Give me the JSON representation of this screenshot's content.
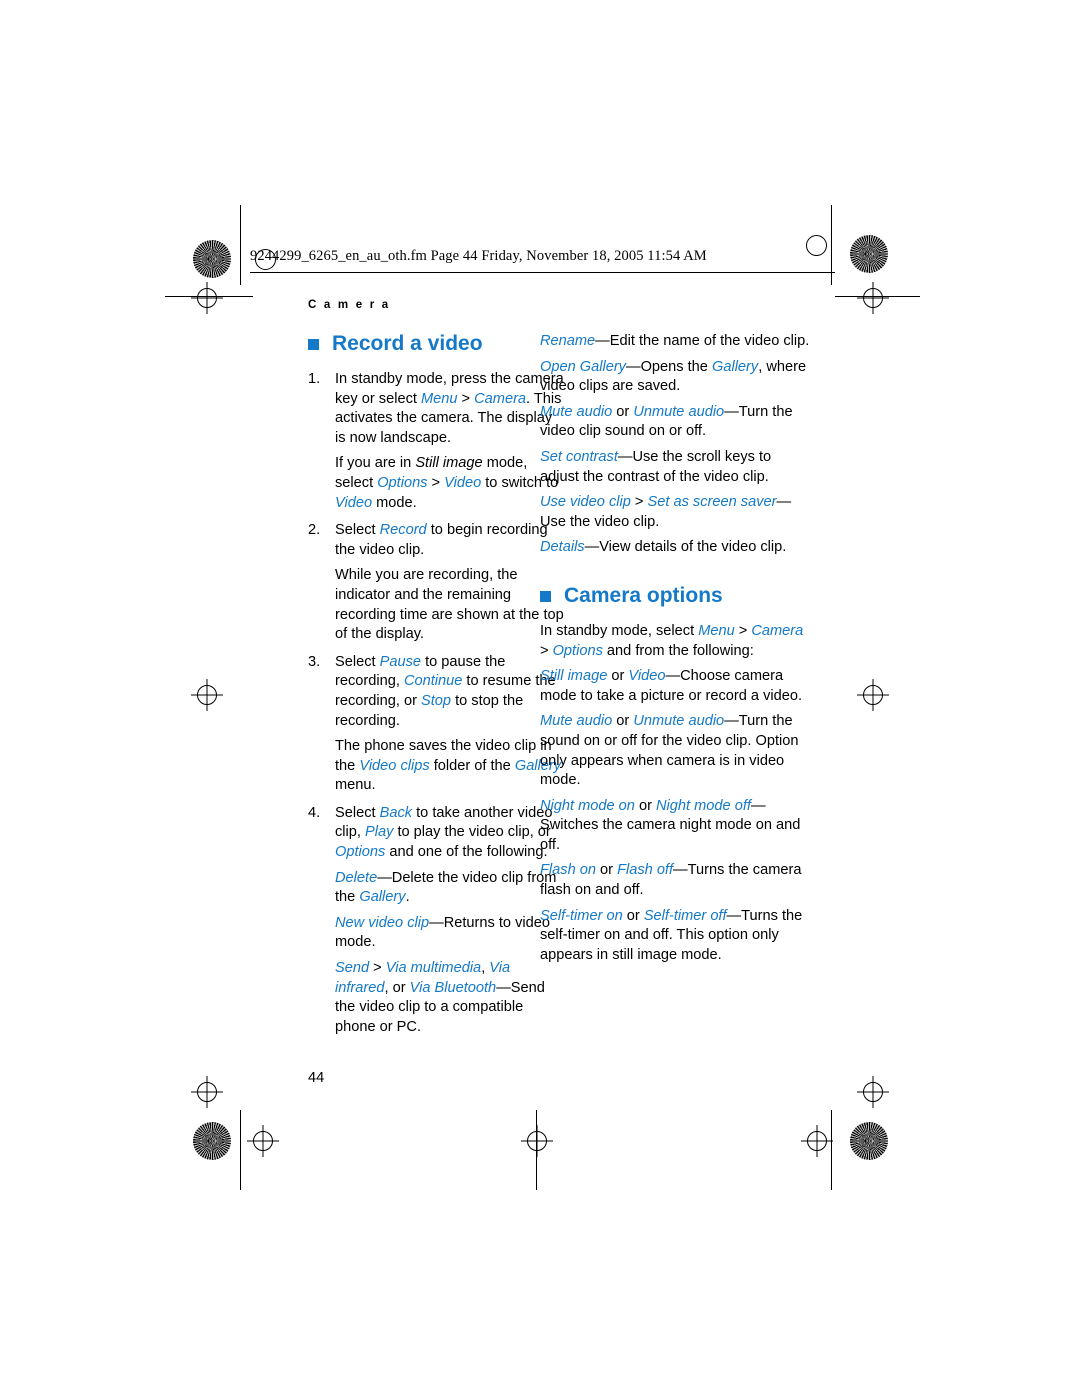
{
  "header": {
    "filename_line": "9244299_6265_en_au_oth.fm  Page 44  Friday, November 18, 2005  11:54 AM",
    "running_head": "C a m e r a"
  },
  "page_number": "44",
  "left_column": {
    "section_title": "Record a video",
    "steps": [
      {
        "num": "1.",
        "parts": [
          {
            "t": "In standby mode, press the camera key or select ",
            "s": "plain"
          },
          {
            "t": "Menu",
            "s": "italic-blue"
          },
          {
            "t": " > ",
            "s": "plain"
          },
          {
            "t": "Camera",
            "s": "italic-blue"
          },
          {
            "t": ". This activates the camera. The display is now landscape.",
            "s": "plain"
          }
        ]
      },
      {
        "num": "2.",
        "parts": [
          {
            "t": "Select ",
            "s": "plain"
          },
          {
            "t": "Record",
            "s": "italic-blue"
          },
          {
            "t": " to begin recording the video clip.",
            "s": "plain"
          }
        ]
      },
      {
        "num": "3.",
        "parts": [
          {
            "t": "Select ",
            "s": "plain"
          },
          {
            "t": "Pause",
            "s": "italic-blue"
          },
          {
            "t": " to pause the recording, ",
            "s": "plain"
          },
          {
            "t": "Continue",
            "s": "italic-blue"
          },
          {
            "t": " to resume the recording, or ",
            "s": "plain"
          },
          {
            "t": "Stop",
            "s": "italic-blue"
          },
          {
            "t": " to stop the recording.",
            "s": "plain"
          }
        ]
      },
      {
        "num": "4.",
        "parts": [
          {
            "t": "Select ",
            "s": "plain"
          },
          {
            "t": "Back",
            "s": "italic-blue"
          },
          {
            "t": " to take another video clip, ",
            "s": "plain"
          },
          {
            "t": "Play",
            "s": "italic-blue"
          },
          {
            "t": " to play the video clip, or ",
            "s": "plain"
          },
          {
            "t": "Options",
            "s": "italic-blue"
          },
          {
            "t": " and one of the following.",
            "s": "plain"
          }
        ]
      }
    ],
    "para_1_after_step1": [
      {
        "t": "If you are in ",
        "s": "plain"
      },
      {
        "t": "Still image",
        "s": "italic-black"
      },
      {
        "t": " mode, select ",
        "s": "plain"
      },
      {
        "t": "Options",
        "s": "italic-blue"
      },
      {
        "t": " > ",
        "s": "plain"
      },
      {
        "t": "Video",
        "s": "italic-blue"
      },
      {
        "t": " to switch to ",
        "s": "plain"
      },
      {
        "t": "Video",
        "s": "italic-blue"
      },
      {
        "t": " mode.",
        "s": "plain"
      }
    ],
    "para_after_step2": [
      {
        "t": "While you are recording, the indicator and the remaining recording time are shown at the top of the display.",
        "s": "plain"
      }
    ],
    "para_after_step3": [
      {
        "t": "The phone saves the video clip in the ",
        "s": "plain"
      },
      {
        "t": "Video clips",
        "s": "italic-blue"
      },
      {
        "t": " folder of the ",
        "s": "plain"
      },
      {
        "t": "Gallery",
        "s": "italic-blue"
      },
      {
        "t": " menu.",
        "s": "plain"
      }
    ],
    "options_after_step4": [
      [
        {
          "t": "Delete",
          "s": "italic-blue"
        },
        {
          "t": "—Delete the video clip from the ",
          "s": "plain"
        },
        {
          "t": "Gallery",
          "s": "italic-blue"
        },
        {
          "t": ".",
          "s": "plain"
        }
      ],
      [
        {
          "t": "New video clip",
          "s": "italic-blue"
        },
        {
          "t": "—Returns to video mode.",
          "s": "plain"
        }
      ],
      [
        {
          "t": "Send",
          "s": "italic-blue"
        },
        {
          "t": " > ",
          "s": "plain"
        },
        {
          "t": "Via multimedia",
          "s": "italic-blue"
        },
        {
          "t": ", ",
          "s": "plain"
        },
        {
          "t": "Via infrared",
          "s": "italic-blue"
        },
        {
          "t": ", or ",
          "s": "plain"
        },
        {
          "t": "Via Bluetooth",
          "s": "italic-blue"
        },
        {
          "t": "—Send the video clip to a compatible phone or PC.",
          "s": "plain"
        }
      ]
    ]
  },
  "right_column": {
    "continued_options": [
      [
        {
          "t": "Rename",
          "s": "italic-blue"
        },
        {
          "t": "—Edit the name of the video clip.",
          "s": "plain"
        }
      ],
      [
        {
          "t": "Open Gallery",
          "s": "italic-blue"
        },
        {
          "t": "—Opens the ",
          "s": "plain"
        },
        {
          "t": "Gallery",
          "s": "italic-blue"
        },
        {
          "t": ", where video clips are saved.",
          "s": "plain"
        }
      ],
      [
        {
          "t": "Mute audio",
          "s": "italic-blue"
        },
        {
          "t": " or ",
          "s": "plain"
        },
        {
          "t": "Unmute audio",
          "s": "italic-blue"
        },
        {
          "t": "—Turn the video clip sound on or off.",
          "s": "plain"
        }
      ],
      [
        {
          "t": "Set contrast",
          "s": "italic-blue"
        },
        {
          "t": "—Use the scroll keys to adjust the contrast of the video clip.",
          "s": "plain"
        }
      ],
      [
        {
          "t": "Use video clip",
          "s": "italic-blue"
        },
        {
          "t": " > ",
          "s": "plain"
        },
        {
          "t": "Set as screen saver",
          "s": "italic-blue"
        },
        {
          "t": "—Use the video clip.",
          "s": "plain"
        }
      ],
      [
        {
          "t": "Details",
          "s": "italic-blue"
        },
        {
          "t": "—View details of the video clip.",
          "s": "plain"
        }
      ]
    ],
    "section_title": "Camera options",
    "intro": [
      {
        "t": "In standby mode, select ",
        "s": "plain"
      },
      {
        "t": "Menu",
        "s": "italic-blue"
      },
      {
        "t": " > ",
        "s": "plain"
      },
      {
        "t": "Camera",
        "s": "italic-blue"
      },
      {
        "t": " > ",
        "s": "plain"
      },
      {
        "t": "Options",
        "s": "italic-blue"
      },
      {
        "t": " and from the following:",
        "s": "plain"
      }
    ],
    "options": [
      [
        {
          "t": "Still image",
          "s": "italic-blue"
        },
        {
          "t": " or ",
          "s": "plain"
        },
        {
          "t": "Video",
          "s": "italic-blue"
        },
        {
          "t": "—Choose camera mode to take a picture or record a video.",
          "s": "plain"
        }
      ],
      [
        {
          "t": "Mute audio",
          "s": "italic-blue"
        },
        {
          "t": " or ",
          "s": "plain"
        },
        {
          "t": "Unmute audio",
          "s": "italic-blue"
        },
        {
          "t": "—Turn the sound on or off for the video clip. Option only appears when camera is in video mode.",
          "s": "plain"
        }
      ],
      [
        {
          "t": "Night mode on",
          "s": "italic-blue"
        },
        {
          "t": " or ",
          "s": "plain"
        },
        {
          "t": "Night mode off",
          "s": "italic-blue"
        },
        {
          "t": "—Switches the camera night mode on and off.",
          "s": "plain"
        }
      ],
      [
        {
          "t": "Flash on",
          "s": "italic-blue"
        },
        {
          "t": " or ",
          "s": "plain"
        },
        {
          "t": "Flash off",
          "s": "italic-blue"
        },
        {
          "t": "—Turns the camera flash on and off.",
          "s": "plain"
        }
      ],
      [
        {
          "t": "Self-timer on",
          "s": "italic-blue"
        },
        {
          "t": " or ",
          "s": "plain"
        },
        {
          "t": "Self-timer off",
          "s": "italic-blue"
        },
        {
          "t": "—Turns the self-timer on and off. This option only appears in still image mode.",
          "s": "plain"
        }
      ]
    ]
  },
  "colors": {
    "accent": "#1479c8",
    "text": "#000000"
  }
}
